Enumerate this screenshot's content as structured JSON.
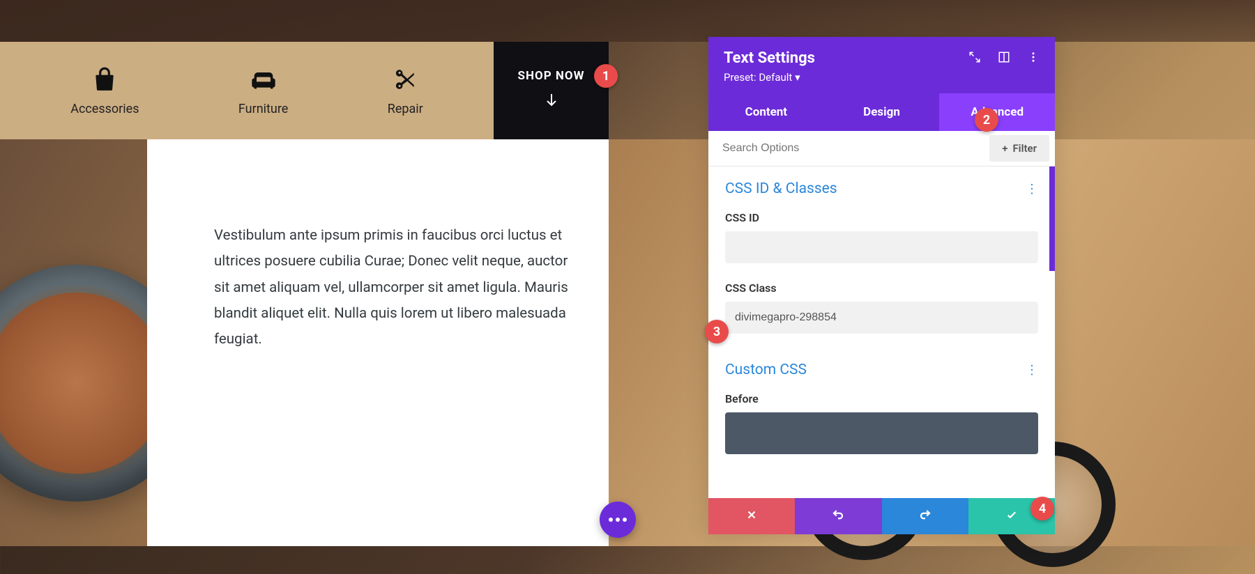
{
  "nav": {
    "items": [
      {
        "label": "Accessories",
        "icon": "bag"
      },
      {
        "label": "Furniture",
        "icon": "sofa"
      },
      {
        "label": "Repair",
        "icon": "scissors"
      }
    ],
    "shop_label": "SHOP NOW"
  },
  "content": {
    "text": "Vestibulum ante ipsum primis in faucibus orci luctus et ultrices posuere cubilia Curae; Donec velit neque, auctor sit amet aliquam vel, ullamcorper sit amet ligula. Mauris blandit aliquet elit. Nulla quis lorem ut libero malesuada feugiat."
  },
  "panel": {
    "title": "Text Settings",
    "preset": "Preset: Default",
    "tabs": {
      "content": "Content",
      "design": "Design",
      "advanced": "Advanced"
    },
    "search_placeholder": "Search Options",
    "filter_label": "Filter",
    "sections": {
      "css_id_classes": {
        "title": "CSS ID & Classes",
        "field_id_label": "CSS ID",
        "field_id_value": "",
        "field_class_label": "CSS Class",
        "field_class_value": "divimegapro-298854"
      },
      "custom_css": {
        "title": "Custom CSS",
        "before_label": "Before"
      }
    }
  },
  "callouts": {
    "c1": "1",
    "c2": "2",
    "c3": "3",
    "c4": "4"
  },
  "colors": {
    "tan": "#ccae83",
    "dark": "#0f0f14",
    "purple": "#6c2bd9",
    "purple_light": "#8a3ffc",
    "link_blue": "#2b87da",
    "red": "#e25563",
    "green": "#29c4a9",
    "callout": "#e94b4b"
  }
}
